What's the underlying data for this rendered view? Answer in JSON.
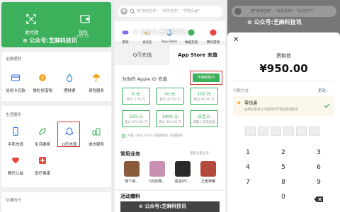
{
  "watermark": "公众号:芝麻科技讯",
  "panel1": {
    "header": {
      "receive_pay": "收付款",
      "wallet": "钱包",
      "wallet_amount": "¥37.37"
    },
    "finance": {
      "title": "金融理财",
      "items": [
        "信用卡还款",
        "微粒贷借钱",
        "理财通",
        "保险服务"
      ]
    },
    "life": {
      "title": "生活服务",
      "items": [
        "手机充值",
        "生活缴费",
        "Q币充值",
        "城市服务",
        "腾讯公益",
        "医疗健康"
      ]
    },
    "travel": {
      "title": "交通出行"
    }
  },
  "panel2": {
    "search_placeholder": "搜\"游戏名称\"、\"会员名称\"、\"付款页面\"",
    "categories": [
      "游戏",
      "会员包",
      "App Store",
      "数据充值",
      "腾讯游戏"
    ],
    "tabs": [
      "Q币充值",
      "App Store 充值"
    ],
    "recharge_title": "为你的 Apple ID 充值",
    "open_button": "开通新账户",
    "options": [
      {
        "amount": "6 元",
        "price": "售价 5.70 元"
      },
      {
        "amount": "50 元",
        "price": "售价 47.50 元"
      },
      {
        "amount": "100 元",
        "price": "售价 95.00 元"
      },
      {
        "amount": "500 元",
        "price": "售价 475.00 元"
      },
      {
        "amount": "1000 元",
        "price": "售价 950.00 元"
      },
      {
        "amount": "自定义",
        "price": "请输入充值金额"
      }
    ],
    "agreement": "同意《App Store 充值服务》充值规则",
    "common_title": "常用业务",
    "common_more": "查看全部业务 ›",
    "games": [
      "地下城...",
      "QQ炫舞...",
      "逆战(PC...",
      "王者荣耀"
    ],
    "activity_title": "活动爆料"
  },
  "panel3": {
    "search_placeholder": "搜\"游戏名称\"、\"会员名称\"、\"试试天下\"",
    "title": "资和信",
    "amount": "¥950.00",
    "pay_method_label": "付款方式",
    "pay_change": "更改 ›",
    "method_name": "零钱通",
    "method_desc": "由腾安基金公司提供货币基金管理服务",
    "keys": [
      "1",
      "2",
      "3",
      "4",
      "5",
      "6",
      "7",
      "8",
      "9",
      "0"
    ]
  }
}
